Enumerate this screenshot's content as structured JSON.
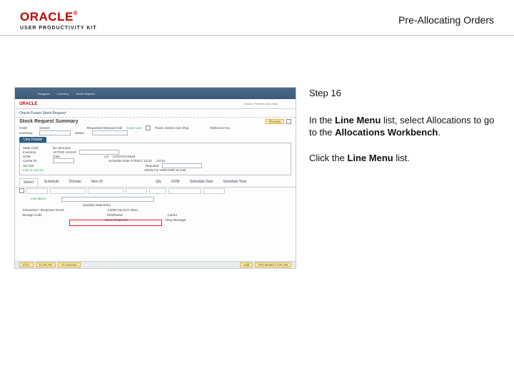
{
  "branding": {
    "logo_text": "ORACLE",
    "tm": "®",
    "subline": "USER PRODUCTIVITY KIT"
  },
  "page_title": "Pre-Allocating Orders",
  "instructions": {
    "step_label": "Step 16",
    "line1_pre": "In the ",
    "line1_bold1": "Line Menu",
    "line1_mid": " list, select Allocations to go to the ",
    "line1_bold2": "Allocations Workbench",
    "line1_post": ".",
    "line2_pre": "Click the ",
    "line2_bold": "Line Menu",
    "line2_post": " list."
  },
  "screenshot": {
    "nav": {
      "a": "Navigator",
      "b": "Inventory",
      "c": "Stock Request"
    },
    "inner_logo": "ORACLE",
    "crumb": "Oracle Fusion Stock Request",
    "heading": "Stock Request Summary",
    "btn_process": "Process",
    "fields": {
      "order_lbl": "Order",
      "order_val": "101123",
      "inv_lbl": "Inventory",
      "stat_lbl": "Status",
      "req_del_lbl": "Requested Demand Call",
      "cross_lbl": "Cross Line",
      "packs_lbl": "Packs Orders Can Ship",
      "ref_lbl": "Reference No"
    },
    "tab": "Line Details",
    "mini": {
      "a1": "State Card",
      "a2": "No Structure",
      "b1": "Inventory",
      "b2": "ACTIVE 102123",
      "c1": "UOM",
      "c2": "Total",
      "d1": "Lot",
      "e1": "LOGISTICS546",
      "f1": "Carrier ID",
      "g1": "Schedule Date 27/03/17 13:32",
      "g2": "14741",
      "h1": "HS-119",
      "i1": "Reported",
      "j1": "Link to Line ID",
      "k1": "JS815 For HMO-IMID at Last"
    },
    "subtabs": {
      "a": "Select",
      "b": "Schedule",
      "c": "Domain",
      "d": "Item ID"
    },
    "cols": {
      "a": "Qty",
      "b": "UOM",
      "c": "Schedule Date",
      "d": "Schedule Time"
    },
    "lower": {
      "a": "Line Menu",
      "b": "Quantity Data Entry",
      "c": "Timeseries / Response Excel",
      "d": "Storage Code",
      "e": "4,0000 ML/ILI/1.4B14",
      "f": "Distributed",
      "g": "Close Requests",
      "h": "Carrier",
      "i": "Ring Message"
    },
    "foot": {
      "a": "Inf.C",
      "b": "T1 PLAN",
      "c": "T1 Horizon",
      "d": "Add",
      "e": "POI M-343 / 2 PLAN"
    }
  }
}
